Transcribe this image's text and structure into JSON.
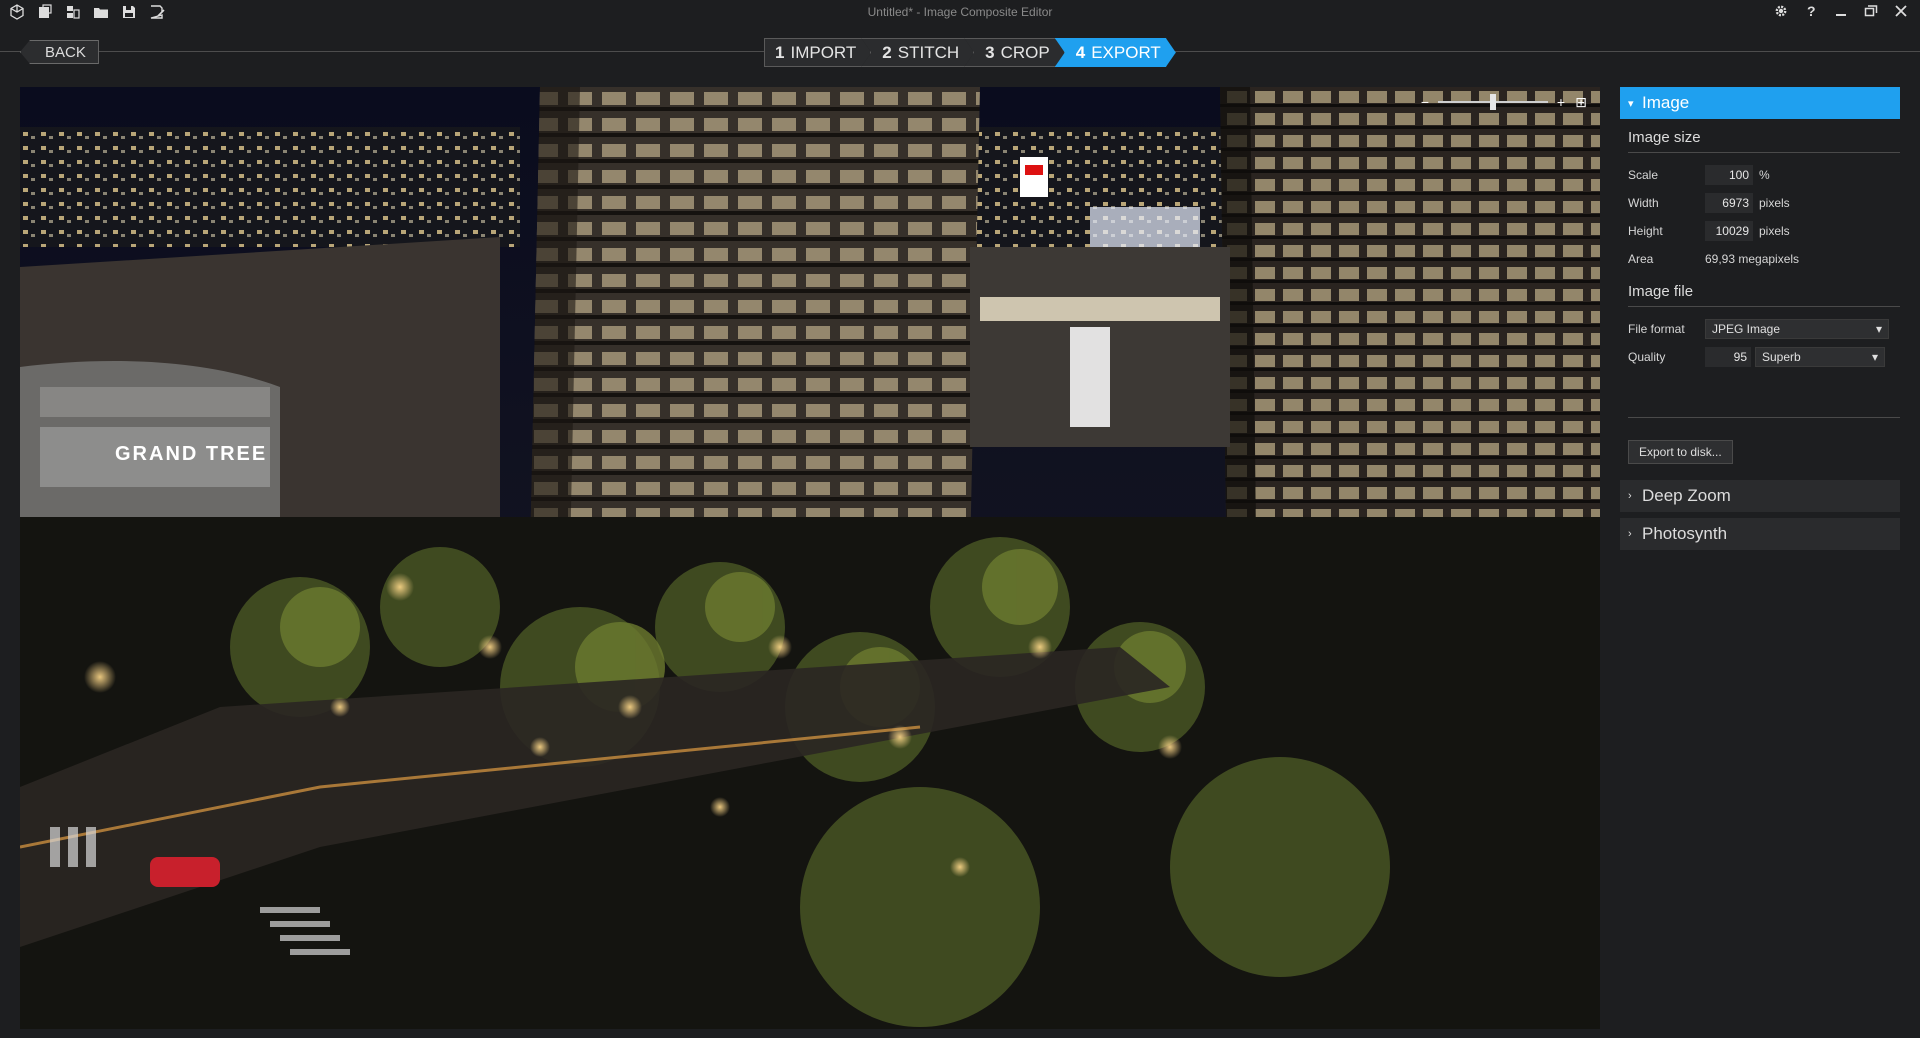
{
  "window": {
    "title": "Untitled* - Image Composite Editor"
  },
  "toolbar": {
    "icons": [
      "new-project-icon",
      "new-panorama-icon",
      "new-video-panorama-icon",
      "open-folder-icon",
      "save-icon",
      "save-as-icon"
    ]
  },
  "window_controls": [
    "gear-icon",
    "help-icon",
    "minimize-icon",
    "restore-icon",
    "close-icon"
  ],
  "nav": {
    "back": "BACK",
    "steps": [
      {
        "num": "1",
        "label": "IMPORT"
      },
      {
        "num": "2",
        "label": "STITCH"
      },
      {
        "num": "3",
        "label": "CROP"
      },
      {
        "num": "4",
        "label": "EXPORT"
      }
    ],
    "active_step": 3
  },
  "colors": {
    "accent": "#1fa0ef",
    "background": "#1d1e20"
  },
  "panel": {
    "image_section": "Image",
    "image_size": {
      "title": "Image size",
      "scale_label": "Scale",
      "scale_value": "100",
      "scale_unit": "%",
      "width_label": "Width",
      "width_value": "6973",
      "width_unit": "pixels",
      "height_label": "Height",
      "height_value": "10029",
      "height_unit": "pixels",
      "area_label": "Area",
      "area_value": "69,93 megapixels"
    },
    "image_file": {
      "title": "Image file",
      "format_label": "File format",
      "format_value": "JPEG Image",
      "quality_label": "Quality",
      "quality_value": "95",
      "quality_preset": "Superb"
    },
    "export_button": "Export to disk...",
    "deep_zoom": "Deep Zoom",
    "photosynth": "Photosynth"
  }
}
